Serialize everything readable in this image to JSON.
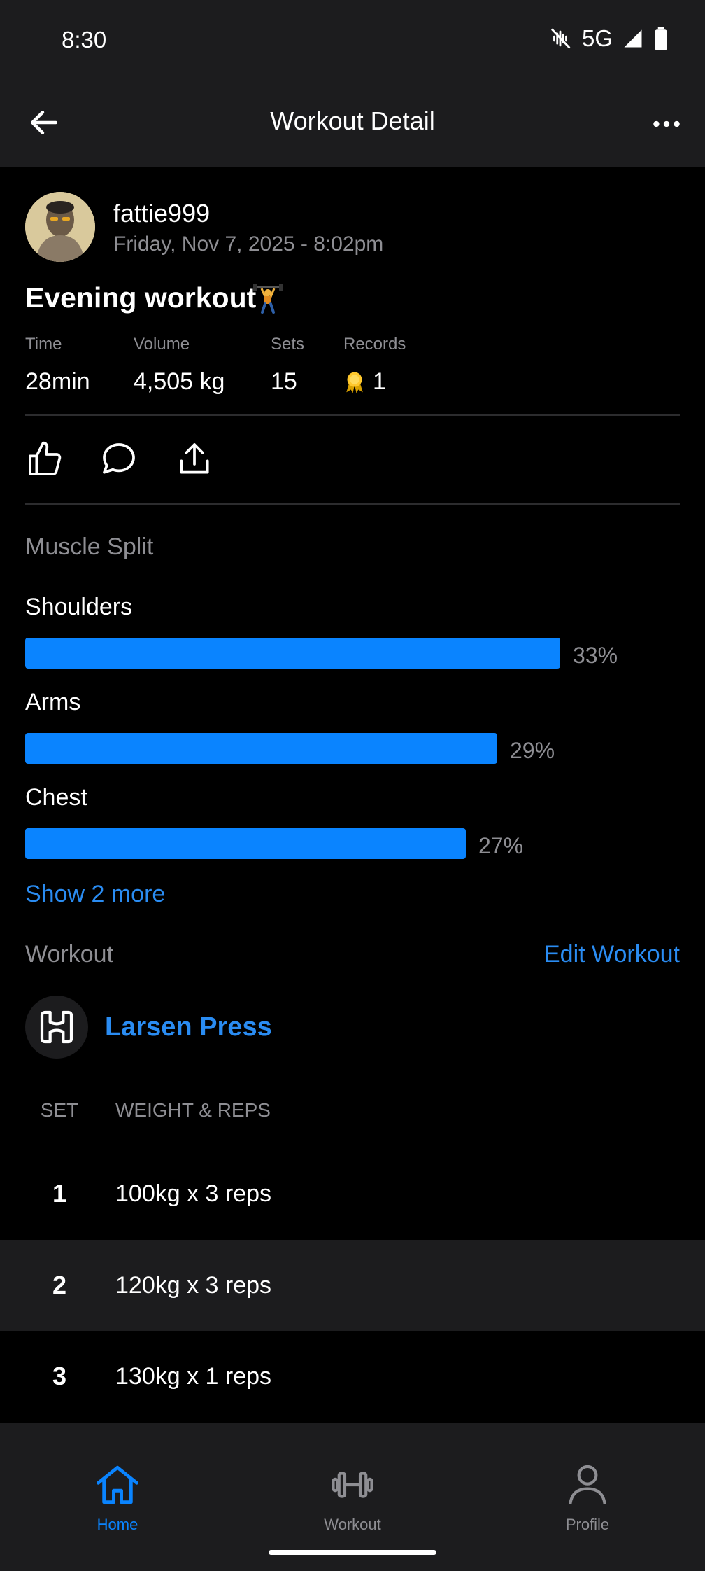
{
  "status_bar": {
    "time": "8:30",
    "network": "5G"
  },
  "app_bar": {
    "title": "Workout Detail"
  },
  "post": {
    "username": "fattie999",
    "datetime": "Friday, Nov 7, 2025 - 8:02pm",
    "title": "Evening workout",
    "title_emoji": "weightlifter-icon",
    "stats": {
      "time_label": "Time",
      "time_value": "28min",
      "volume_label": "Volume",
      "volume_value": "4,505 kg",
      "sets_label": "Sets",
      "sets_value": "15",
      "records_label": "Records",
      "records_value": "1"
    }
  },
  "actions": [
    "like-icon",
    "comment-icon",
    "share-icon"
  ],
  "muscle_split": {
    "label": "Muscle Split",
    "items": [
      {
        "name": "Shoulders",
        "percent_label": "33%",
        "fill_fraction": 0.33
      },
      {
        "name": "Arms",
        "percent_label": "29%",
        "fill_fraction": 0.29
      },
      {
        "name": "Chest",
        "percent_label": "27%",
        "fill_fraction": 0.27
      }
    ],
    "show_more": "Show 2 more"
  },
  "workout_section": {
    "label": "Workout",
    "edit_label": "Edit Workout",
    "exercise": {
      "name": "Larsen Press",
      "icon": "dumbbell-logo-icon",
      "col_set": "SET",
      "col_weight": "WEIGHT & REPS",
      "sets": [
        {
          "num": "1",
          "value": "100kg x 3 reps"
        },
        {
          "num": "2",
          "value": "120kg x 3 reps"
        },
        {
          "num": "3",
          "value": "130kg x 1 reps"
        }
      ]
    }
  },
  "bottom_nav": {
    "items": [
      {
        "label": "Home",
        "active": true
      },
      {
        "label": "Workout",
        "active": false
      },
      {
        "label": "Profile",
        "active": false
      }
    ]
  },
  "colors": {
    "accent": "#0a84ff",
    "link": "#2a8cf2",
    "muted": "#8e8e93",
    "surface": "#1c1c1e"
  }
}
